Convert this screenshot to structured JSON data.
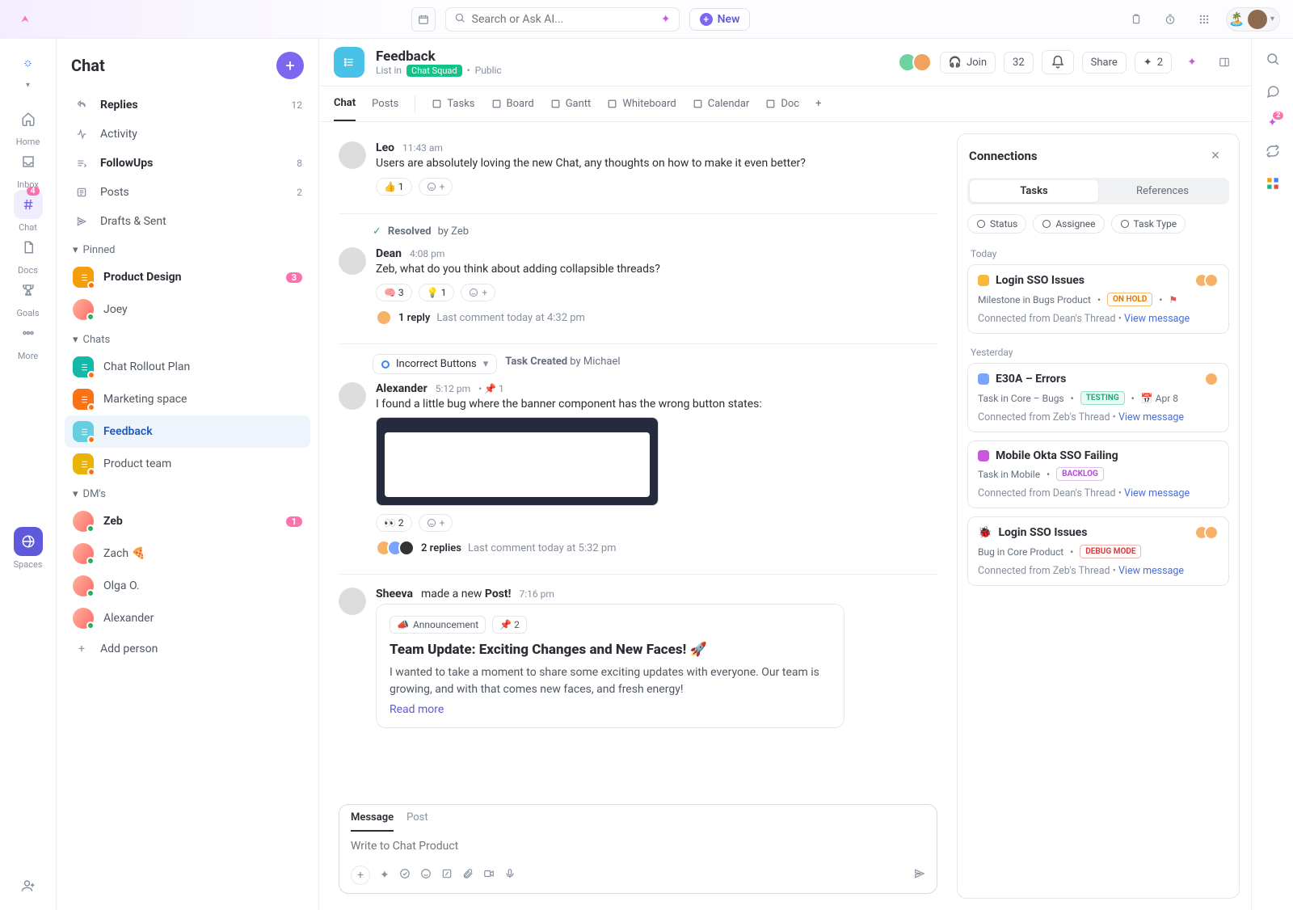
{
  "topbar": {
    "search_placeholder": "Search or Ask AI...",
    "new_label": "New"
  },
  "rail": {
    "items": [
      {
        "label": "Home",
        "icon": "home"
      },
      {
        "label": "Inbox",
        "icon": "inbox"
      },
      {
        "label": "Chat",
        "icon": "hash",
        "active": true,
        "badge": "4"
      },
      {
        "label": "Docs",
        "icon": "doc"
      },
      {
        "label": "Goals",
        "icon": "trophy"
      },
      {
        "label": "More",
        "icon": "dots"
      }
    ],
    "spaces_label": "Spaces"
  },
  "sidebar": {
    "title": "Chat",
    "sections": [
      {
        "label": "Replies",
        "count": "12",
        "bold": true,
        "icon": "reply"
      },
      {
        "label": "Activity",
        "icon": "activity"
      },
      {
        "label": "FollowUps",
        "count": "8",
        "bold": true,
        "icon": "followup"
      },
      {
        "label": "Posts",
        "count": "2",
        "icon": "posts"
      },
      {
        "label": "Drafts & Sent",
        "icon": "drafts"
      }
    ],
    "pinned_title": "Pinned",
    "pinned": [
      {
        "label": "Product Design",
        "badge": "3",
        "bold": true,
        "type": "channel",
        "color": "#f59e0b"
      },
      {
        "label": "Joey",
        "type": "dm"
      }
    ],
    "chats_title": "Chats",
    "chats": [
      {
        "label": "Chat Rollout Plan",
        "type": "channel",
        "color": "#14b8a6"
      },
      {
        "label": "Marketing space",
        "type": "channel",
        "color": "#f97316"
      },
      {
        "label": "Feedback",
        "type": "channel",
        "active": true,
        "color": "#67cde0"
      },
      {
        "label": "Product team",
        "type": "channel",
        "color": "#eab308"
      }
    ],
    "dms_title": "DM's",
    "dms": [
      {
        "label": "Zeb",
        "badge": "1",
        "bold": true
      },
      {
        "label": "Zach 🍕"
      },
      {
        "label": "Olga O."
      },
      {
        "label": "Alexander"
      }
    ],
    "add_person": "Add person"
  },
  "header": {
    "title": "Feedback",
    "list_in": "List in",
    "squad": "Chat Squad",
    "visibility": "Public",
    "join": "Join",
    "count": "32",
    "share": "Share",
    "guests": "2"
  },
  "views": [
    "Chat",
    "Posts",
    "Tasks",
    "Board",
    "Gantt",
    "Whiteboard",
    "Calendar",
    "Doc"
  ],
  "messages": [
    {
      "author": "Leo",
      "time": "11:43 am",
      "text": "Users are absolutely loving the new Chat, any thoughts on how to make it even better?",
      "reactions": [
        {
          "e": "👍",
          "c": "1"
        }
      ]
    },
    {
      "resolved_by": "Zeb",
      "author": "Dean",
      "time": "4:08 pm",
      "text": "Zeb, what do you think about adding collapsible threads?",
      "reactions": [
        {
          "e": "🧠",
          "c": "3"
        },
        {
          "e": "💡",
          "c": "1"
        }
      ],
      "reply_count": "1 reply",
      "last_comment": "Last comment today at 4:32 pm"
    },
    {
      "task_name": "Incorrect Buttons",
      "task_created": "Task Created",
      "task_by": "by Michael",
      "author": "Alexander",
      "time": "5:12 pm",
      "pins": "1",
      "text": "I found a little bug where the banner component has the wrong button states:",
      "has_image": true,
      "reactions": [
        {
          "e": "👀",
          "c": "2"
        }
      ],
      "reply_count": "2 replies",
      "last_comment": "Last comment today at 5:32 pm"
    },
    {
      "author": "Sheeva",
      "post_verb": "made a new",
      "post_noun": "Post!",
      "time": "7:16 pm",
      "post": {
        "tag": "Announcement",
        "pins": "2",
        "title": "Team Update: Exciting Changes and New Faces! 🚀",
        "body": "I wanted to take a moment to share some exciting updates with everyone. Our team is growing, and with that comes new faces, and fresh energy!",
        "read_more": "Read more"
      }
    }
  ],
  "resolved_label": "Resolved",
  "composer": {
    "tabs": [
      "Message",
      "Post"
    ],
    "placeholder": "Write to Chat Product"
  },
  "connections": {
    "title": "Connections",
    "tabs": [
      "Tasks",
      "References"
    ],
    "filters": [
      "Status",
      "Assignee",
      "Task Type"
    ],
    "groups": [
      {
        "label": "Today",
        "cards": [
          {
            "icon": "#f6b93b",
            "title": "Login SSO Issues",
            "sub": "Milestone in Bugs Product",
            "status": "ON HOLD",
            "status_cls": "onhold",
            "flag": true,
            "from": "Connected from Dean's Thread",
            "link": "View message",
            "avatars": 2
          }
        ]
      },
      {
        "label": "Yesterday",
        "cards": [
          {
            "icon": "#7aa5ff",
            "title": "E30A – Errors",
            "sub": "Task in Core – Bugs",
            "status": "TESTING",
            "status_cls": "testing",
            "date": "Apr 8",
            "from": "Connected from Zeb's Thread",
            "link": "View message",
            "avatars": 1
          },
          {
            "icon": "#c858e0",
            "title": "Mobile Okta SSO Failing",
            "sub": "Task in Mobile",
            "status": "BACKLOG",
            "status_cls": "backlog",
            "from": "Connected from Dean's Thread",
            "link": "View message"
          },
          {
            "icon": "#ef4444",
            "bug": true,
            "title": "Login SSO Issues",
            "sub": "Bug in Core Product",
            "status": "DEBUG MODE",
            "status_cls": "debug",
            "from": "Connected from Zeb's Thread",
            "link": "View message",
            "avatars": 2
          }
        ]
      }
    ]
  }
}
